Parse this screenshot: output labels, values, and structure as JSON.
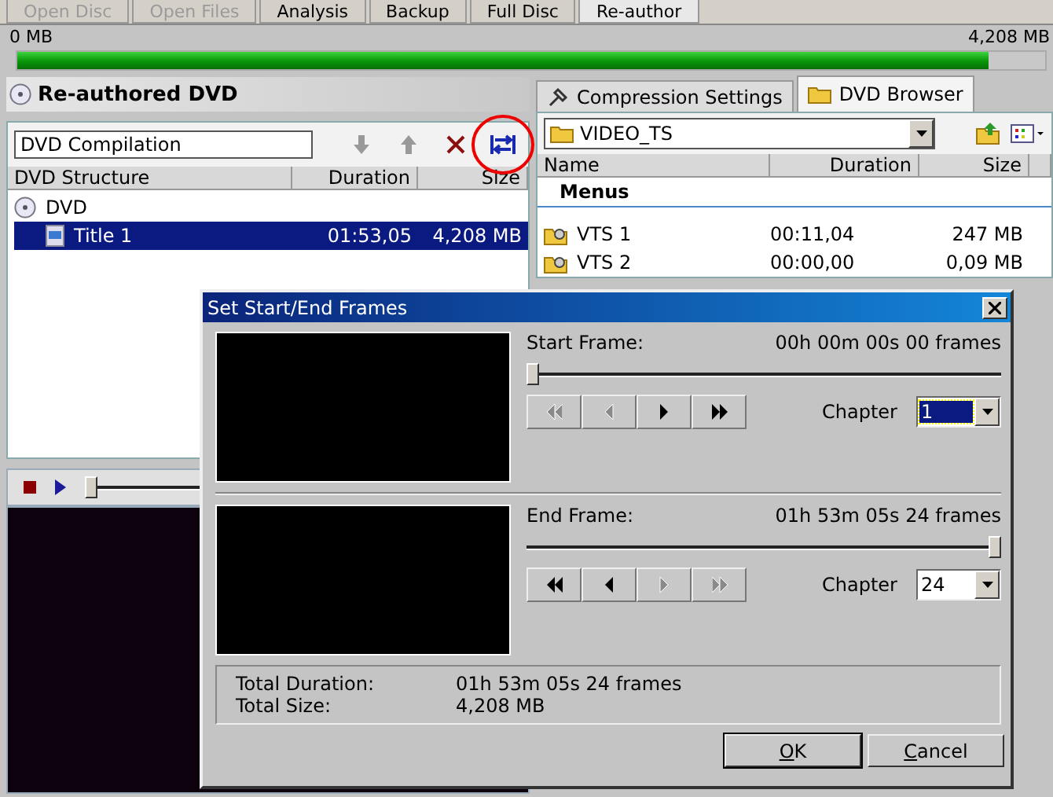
{
  "top_tabs": [
    {
      "label": "Open Disc",
      "selected": false,
      "disabled": true
    },
    {
      "label": "Open Files",
      "selected": false,
      "disabled": true
    },
    {
      "label": "Analysis",
      "selected": false,
      "disabled": false
    },
    {
      "label": "Backup",
      "selected": false,
      "disabled": false
    },
    {
      "label": "Full Disc",
      "selected": false,
      "disabled": false
    },
    {
      "label": "Re-author",
      "selected": true,
      "disabled": false
    }
  ],
  "progress": {
    "min_label": "0 MB",
    "max_label": "4,208 MB",
    "level": 0.945
  },
  "left_panel": {
    "title": "Re-authored DVD",
    "name_field": {
      "value": "DVD Compilation"
    },
    "toolbar": [
      {
        "kind": "down",
        "disabled": true,
        "highlighted": false
      },
      {
        "kind": "up",
        "disabled": true,
        "highlighted": false
      },
      {
        "kind": "delete",
        "disabled": false,
        "highlighted": false
      },
      {
        "kind": "frames",
        "disabled": false,
        "highlighted": true
      }
    ],
    "columns": [
      "DVD Structure",
      "Duration",
      "Size"
    ],
    "tree": [
      {
        "label": "DVD",
        "kind": "disc",
        "selected": false,
        "children": [
          {
            "label": "Title 1",
            "kind": "title",
            "duration": "01:53,05",
            "size": "4,208 MB",
            "selected": true
          }
        ]
      }
    ],
    "player": {
      "level": 0
    }
  },
  "right_panel": {
    "tabs": [
      {
        "label": "Compression Settings",
        "kind": "settings",
        "selected": false
      },
      {
        "label": "DVD Browser",
        "kind": "folder",
        "selected": true
      }
    ],
    "folder": "VIDEO_TS",
    "columns": [
      "Name",
      "Duration",
      "Size"
    ],
    "group": "Menus",
    "rows": [
      {
        "name": "VTS 1",
        "duration": "00:11,04",
        "size": "247 MB"
      },
      {
        "name": "VTS 2",
        "duration": "00:00,00",
        "size": "0,09 MB"
      }
    ]
  },
  "dialog": {
    "title": "Set Start/End Frames",
    "sections": [
      {
        "label": "Start Frame:",
        "time": "00h 00m 00s 00 frames",
        "level": 0,
        "chapter_label": "Chapter",
        "chapter": "1",
        "chapter_focused": true,
        "buttons": [
          {
            "kind": "first",
            "disabled": true
          },
          {
            "kind": "prev",
            "disabled": true
          },
          {
            "kind": "next",
            "disabled": false
          },
          {
            "kind": "last",
            "disabled": false
          }
        ]
      },
      {
        "label": "End Frame:",
        "time": "01h 53m 05s 24 frames",
        "level": 1,
        "chapter_label": "Chapter",
        "chapter": "24",
        "chapter_focused": false,
        "buttons": [
          {
            "kind": "first",
            "disabled": false
          },
          {
            "kind": "prev",
            "disabled": false
          },
          {
            "kind": "next",
            "disabled": true
          },
          {
            "kind": "last",
            "disabled": true
          }
        ]
      }
    ],
    "summary": [
      {
        "label": "Total Duration:",
        "value": "01h 53m 05s 24 frames"
      },
      {
        "label": "Total Size:",
        "value": "4,208 MB"
      }
    ],
    "buttons": [
      "OK",
      "Cancel"
    ]
  }
}
